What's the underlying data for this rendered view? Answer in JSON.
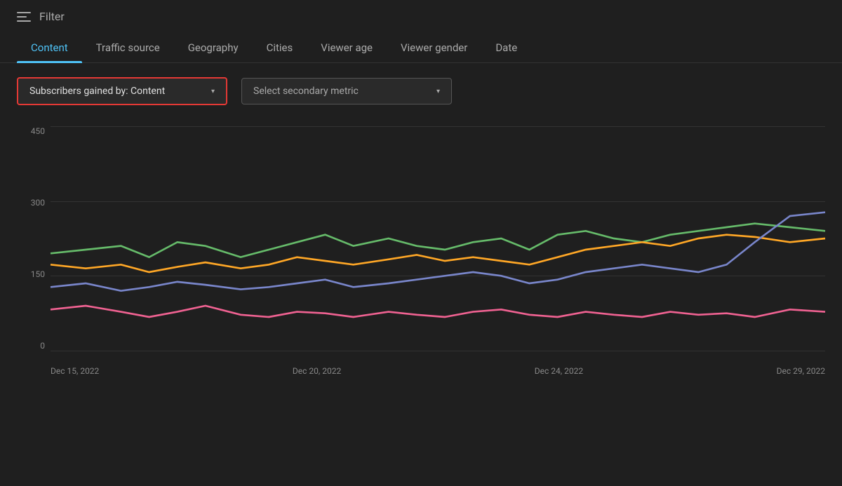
{
  "filter": {
    "icon_label": "filter-icon",
    "label": "Filter"
  },
  "tabs": {
    "items": [
      {
        "id": "content",
        "label": "Content",
        "active": true
      },
      {
        "id": "traffic-source",
        "label": "Traffic source",
        "active": false
      },
      {
        "id": "geography",
        "label": "Geography",
        "active": false
      },
      {
        "id": "cities",
        "label": "Cities",
        "active": false
      },
      {
        "id": "viewer-age",
        "label": "Viewer age",
        "active": false
      },
      {
        "id": "viewer-gender",
        "label": "Viewer gender",
        "active": false
      },
      {
        "id": "date",
        "label": "Date",
        "active": false
      }
    ]
  },
  "controls": {
    "primary_metric": {
      "label": "Subscribers gained by: Content",
      "chevron": "▾"
    },
    "secondary_metric": {
      "label": "Select secondary metric",
      "chevron": "▾"
    }
  },
  "chart": {
    "y_labels": [
      "450",
      "300",
      "150",
      "0"
    ],
    "x_labels": [
      "Dec 15, 2022",
      "Dec 20, 2022",
      "Dec 24, 2022",
      "Dec 29, 2022"
    ],
    "colors": {
      "green": "#66bb6a",
      "orange": "#ffa726",
      "blue": "#7986cb",
      "pink": "#f06292",
      "teal": "#4db6ac"
    }
  }
}
